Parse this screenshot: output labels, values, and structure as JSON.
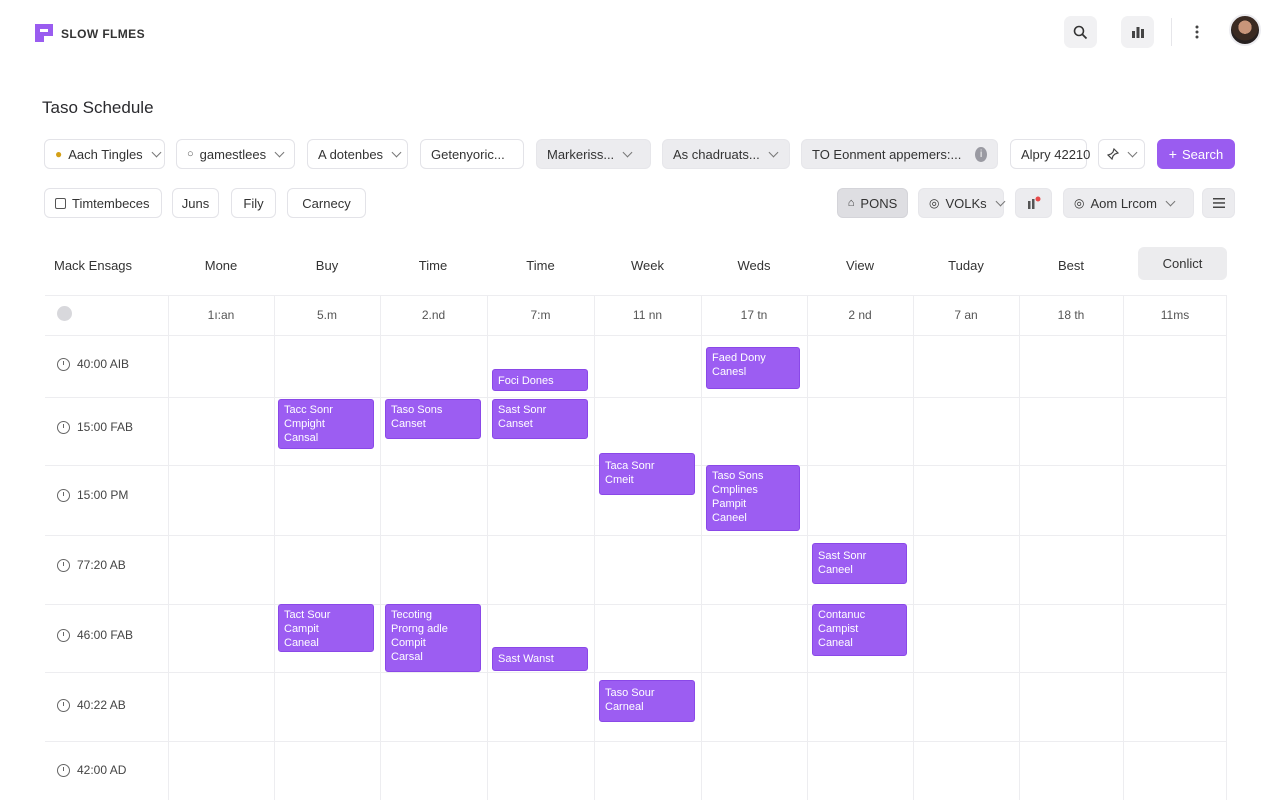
{
  "app": {
    "brand": "SLOW FLMES",
    "brand_color": "#9a5cf0"
  },
  "topbar": {
    "icons": [
      "search-icon",
      "bar-chart-icon",
      "more-vertical-icon",
      "avatar"
    ]
  },
  "page": {
    "title": "Taso Schedule"
  },
  "filters_row1": [
    {
      "label": "Aach Tingles",
      "icon": "person-icon"
    },
    {
      "label": "gamestlees",
      "icon": "person-icon"
    },
    {
      "label": "A dotenbes"
    },
    {
      "label": "Getenyoric..."
    },
    {
      "label": "Markeriss..."
    },
    {
      "label": "As chadruats..."
    },
    {
      "label": "TO Eonment appemers:..."
    },
    {
      "label": "Alpry 42210"
    }
  ],
  "search": {
    "label": "Search"
  },
  "filters_row2": {
    "checkbox_label": "Timtembeces",
    "chips": [
      "Juns",
      "Fily",
      "Carnecy"
    ],
    "right": {
      "pons": "PONS",
      "vlks": "VOLKs",
      "room": "Aom Lrcom"
    }
  },
  "grid": {
    "header": [
      "Mack Ensags",
      "Mone",
      "Buy",
      "Time",
      "Time",
      "Week",
      "Weds",
      "View",
      "Tuday",
      "Best"
    ],
    "conflict_label": "Conlict",
    "subheader": [
      "1ı:an",
      "5.m",
      "2.nd",
      "7:m",
      "11 nn",
      "17 tn",
      "2 nd",
      "7 an",
      "18 th",
      "11ms"
    ],
    "times": [
      "40:00 AIB",
      "15:00 FAB",
      "15:00 PM",
      "77:20 AB",
      "46:00 FAB",
      "40:22 AB",
      "42:00 AD"
    ],
    "events": [
      {
        "lines": [
          "Foci Dones"
        ]
      },
      {
        "lines": [
          "Faed Dony",
          "Canesl"
        ]
      },
      {
        "lines": [
          "Tacc Sonr",
          "Cmpight",
          "Cansal"
        ]
      },
      {
        "lines": [
          "Taso Sons",
          "Canset"
        ]
      },
      {
        "lines": [
          "Sast Sonr",
          "Canset"
        ]
      },
      {
        "lines": [
          "Taca Sonr",
          "Cmeit"
        ]
      },
      {
        "lines": [
          "Taso Sons",
          "Cmplines",
          "Pampit",
          "Caneel"
        ]
      },
      {
        "lines": [
          "Sast Sonr",
          "Caneel"
        ]
      },
      {
        "lines": [
          "Tact Sour",
          "Campit",
          "Caneal"
        ]
      },
      {
        "lines": [
          "Tecoting",
          "Prorng adle",
          "Compit",
          "Carsal"
        ]
      },
      {
        "lines": [
          "Contanuc",
          "Campist",
          "Caneal"
        ]
      },
      {
        "lines": [
          "Sast Wanst"
        ]
      },
      {
        "lines": [
          "Taso Sour",
          "Carneal"
        ]
      }
    ]
  }
}
